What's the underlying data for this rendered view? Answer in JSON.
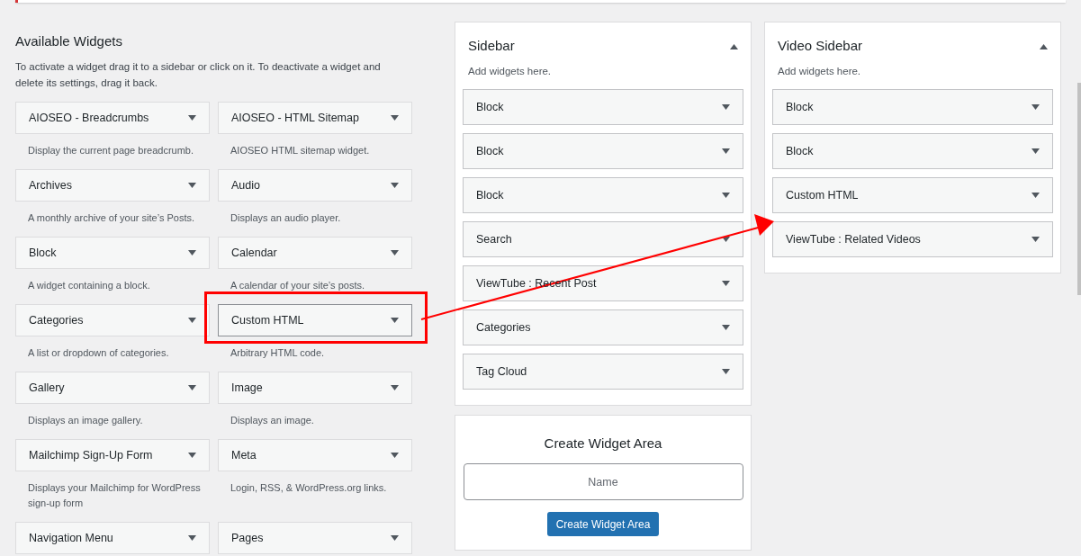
{
  "available": {
    "title": "Available Widgets",
    "description": "To activate a widget drag it to a sidebar or click on it. To deactivate a widget and delete its settings, drag it back.",
    "widgets": [
      {
        "name": "AIOSEO - Breadcrumbs",
        "description": "Display the current page breadcrumb.",
        "highlighted": false
      },
      {
        "name": "AIOSEO - HTML Sitemap",
        "description": "AIOSEO HTML sitemap widget.",
        "highlighted": false
      },
      {
        "name": "Archives",
        "description": "A monthly archive of your site’s Posts.",
        "highlighted": false
      },
      {
        "name": "Audio",
        "description": "Displays an audio player.",
        "highlighted": false
      },
      {
        "name": "Block",
        "description": "A widget containing a block.",
        "highlighted": false
      },
      {
        "name": "Calendar",
        "description": "A calendar of your site’s posts.",
        "highlighted": false
      },
      {
        "name": "Categories",
        "description": "A list or dropdown of categories.",
        "highlighted": false
      },
      {
        "name": "Custom HTML",
        "description": "Arbitrary HTML code.",
        "highlighted": true
      },
      {
        "name": "Gallery",
        "description": "Displays an image gallery.",
        "highlighted": false
      },
      {
        "name": "Image",
        "description": "Displays an image.",
        "highlighted": false
      },
      {
        "name": "Mailchimp Sign-Up Form",
        "description": "Displays your Mailchimp for WordPress sign-up form",
        "highlighted": false
      },
      {
        "name": "Meta",
        "description": "Login, RSS, & WordPress.org links.",
        "highlighted": false
      },
      {
        "name": "Navigation Menu",
        "highlighted": false
      },
      {
        "name": "Pages",
        "highlighted": false
      }
    ]
  },
  "sidebars": [
    {
      "title": "Sidebar",
      "hint": "Add widgets here.",
      "expanded": true,
      "widgets": [
        "Block",
        "Block",
        "Block",
        "Search",
        "ViewTube : Recent Post",
        "Categories",
        "Tag Cloud"
      ]
    },
    {
      "title": "Video Sidebar",
      "hint": "Add widgets here.",
      "expanded": true,
      "widgets": [
        "Block",
        "Block",
        "Custom HTML",
        "ViewTube : Related Videos"
      ]
    }
  ],
  "create_area": {
    "title": "Create Widget Area",
    "placeholder": "Name",
    "button": "Create Widget Area"
  }
}
